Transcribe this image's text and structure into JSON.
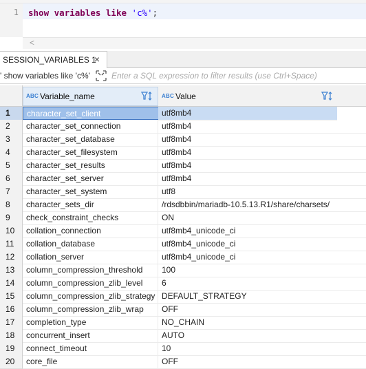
{
  "editor": {
    "line_number": "1",
    "tokens": [
      "show",
      " ",
      "variables",
      " ",
      "like",
      " ",
      "'c%'",
      ";"
    ]
  },
  "tab": {
    "label": "SESSION_VARIABLES 1",
    "close": "×"
  },
  "filter": {
    "query": "' show variables like 'c%'",
    "placeholder": "Enter a SQL expression to filter results (use Ctrl+Space)"
  },
  "grid": {
    "type_badge": "ABC",
    "columns": [
      "Variable_name",
      "Value"
    ],
    "selected_row": 1,
    "rows": [
      {
        "n": "1",
        "name": "character_set_client",
        "value": "utf8mb4"
      },
      {
        "n": "2",
        "name": "character_set_connection",
        "value": "utf8mb4"
      },
      {
        "n": "3",
        "name": "character_set_database",
        "value": "utf8mb4"
      },
      {
        "n": "4",
        "name": "character_set_filesystem",
        "value": "utf8mb4"
      },
      {
        "n": "5",
        "name": "character_set_results",
        "value": "utf8mb4"
      },
      {
        "n": "6",
        "name": "character_set_server",
        "value": "utf8mb4"
      },
      {
        "n": "7",
        "name": "character_set_system",
        "value": "utf8"
      },
      {
        "n": "8",
        "name": "character_sets_dir",
        "value": "/rdsdbbin/mariadb-10.5.13.R1/share/charsets/"
      },
      {
        "n": "9",
        "name": "check_constraint_checks",
        "value": "ON"
      },
      {
        "n": "10",
        "name": "collation_connection",
        "value": "utf8mb4_unicode_ci"
      },
      {
        "n": "11",
        "name": "collation_database",
        "value": "utf8mb4_unicode_ci"
      },
      {
        "n": "12",
        "name": "collation_server",
        "value": "utf8mb4_unicode_ci"
      },
      {
        "n": "13",
        "name": "column_compression_threshold",
        "value": "100"
      },
      {
        "n": "14",
        "name": "column_compression_zlib_level",
        "value": "6"
      },
      {
        "n": "15",
        "name": "column_compression_zlib_strategy",
        "value": "DEFAULT_STRATEGY"
      },
      {
        "n": "16",
        "name": "column_compression_zlib_wrap",
        "value": "OFF"
      },
      {
        "n": "17",
        "name": "completion_type",
        "value": "NO_CHAIN"
      },
      {
        "n": "18",
        "name": "concurrent_insert",
        "value": "AUTO"
      },
      {
        "n": "19",
        "name": "connect_timeout",
        "value": "10"
      },
      {
        "n": "20",
        "name": "core_file",
        "value": "OFF"
      }
    ]
  },
  "colors": {
    "keyword": "#7f0055",
    "string": "#2a00ff",
    "selection": "#9fc0ea",
    "accent": "#3a7fd1"
  }
}
